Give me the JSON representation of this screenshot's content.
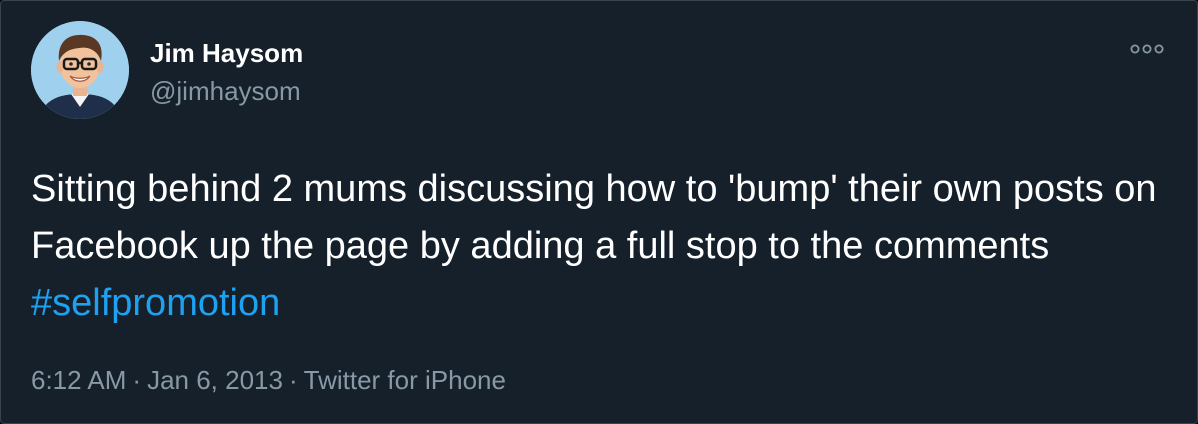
{
  "author": {
    "name": "Jim Haysom",
    "handle": "@jimhaysom"
  },
  "tweet": {
    "text": "Sitting behind 2 mums discussing how to 'bump' their own posts on Facebook up the page by adding a full stop to the comments ",
    "hashtag": "#selfpromotion"
  },
  "meta": {
    "time": "6:12 AM",
    "separator": "·",
    "date": "Jan 6, 2013",
    "source": "Twitter for iPhone"
  },
  "icons": {
    "more": "more-options-icon",
    "avatar": "avatar-illustration"
  },
  "colors": {
    "background": "#15202b",
    "border": "#38444d",
    "text": "#ffffff",
    "secondary_text": "#8899a6",
    "link": "#1da1f2"
  }
}
